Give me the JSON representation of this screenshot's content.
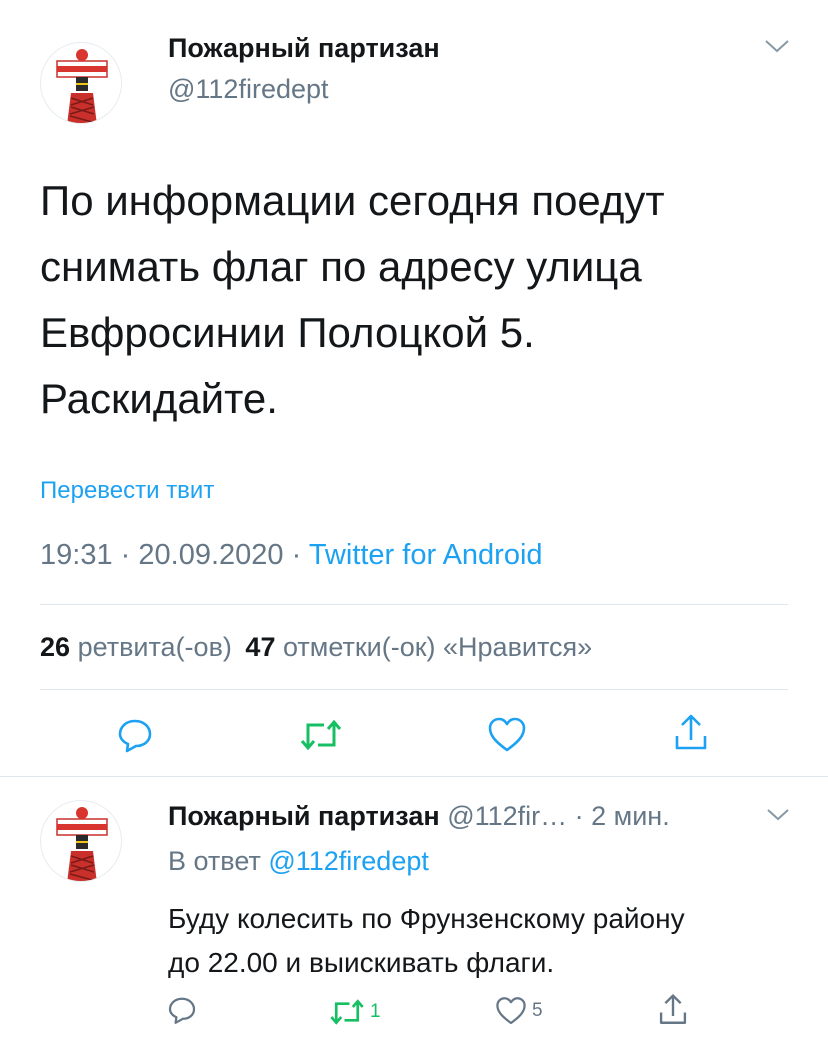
{
  "main_tweet": {
    "author_name": "Пожарный партизан",
    "author_handle": "@112firedept",
    "text_lines": [
      "По информации сегодня поедут",
      "снимать флаг по адресу улица",
      "Евфросинии Полоцкой 5.",
      "Раскидайте."
    ],
    "translate_label": "Перевести твит",
    "time": "19:31",
    "date": "20.09.2020",
    "separator": "·",
    "source": "Twitter for Android",
    "retweets_count": "26",
    "retweets_label": "ретвита(-ов)",
    "likes_count": "47",
    "likes_label": "отметки(-ок) «Нравится»"
  },
  "reply_tweet": {
    "author_name": "Пожарный партизан",
    "author_handle": "@112fir…",
    "time_ago": "· 2 мин.",
    "reply_prefix": "В ответ",
    "reply_to": "@112firedept",
    "text_lines": [
      "Буду колесить по Фрунзенскому району",
      "до 22.00 и выискивать флаги."
    ],
    "retweet_count": "1",
    "like_count": "5"
  },
  "icons": {
    "reply": "reply-bubble-icon",
    "retweet": "retweet-icon",
    "like": "heart-icon",
    "share": "share-icon",
    "menu": "chevron-down-icon"
  },
  "colors": {
    "accent": "#1da1f2",
    "retweet_green": "#17bf63",
    "text": "#14171a",
    "muted": "#657786"
  }
}
